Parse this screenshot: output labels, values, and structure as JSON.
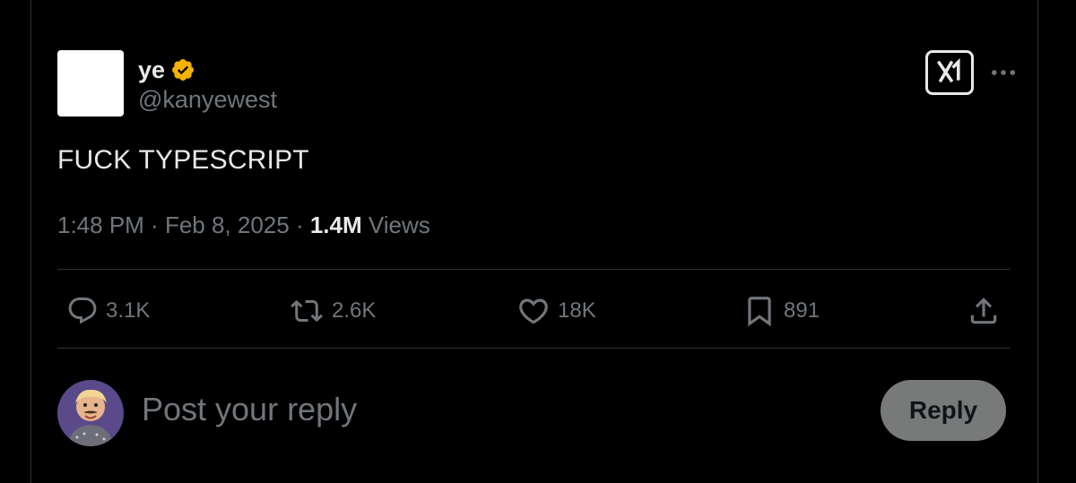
{
  "author": {
    "display_name": "ye",
    "handle": "@kanyewest",
    "verified_badge_icon": "verified-badge-icon",
    "badge_color": "#f4b300"
  },
  "header_actions": {
    "grok_icon": "grok-icon",
    "more_icon": "more-horizontal-icon"
  },
  "tweet": {
    "text": "FUCK TYPESCRIPT",
    "time": "1:48 PM",
    "sep1": " · ",
    "date": "Feb 8, 2025",
    "sep2": " · ",
    "views_count": "1.4M",
    "views_label": " Views"
  },
  "actions": {
    "replies": "3.1K",
    "reposts": "2.6K",
    "likes": "18K",
    "bookmarks": "891"
  },
  "reply_box": {
    "placeholder": "Post your reply",
    "button_label": "Reply"
  },
  "colors": {
    "background": "#000000",
    "text": "#e7e9ea",
    "muted": "#71767b",
    "border": "#2f3336",
    "reply_button_bg": "#787a7a"
  }
}
